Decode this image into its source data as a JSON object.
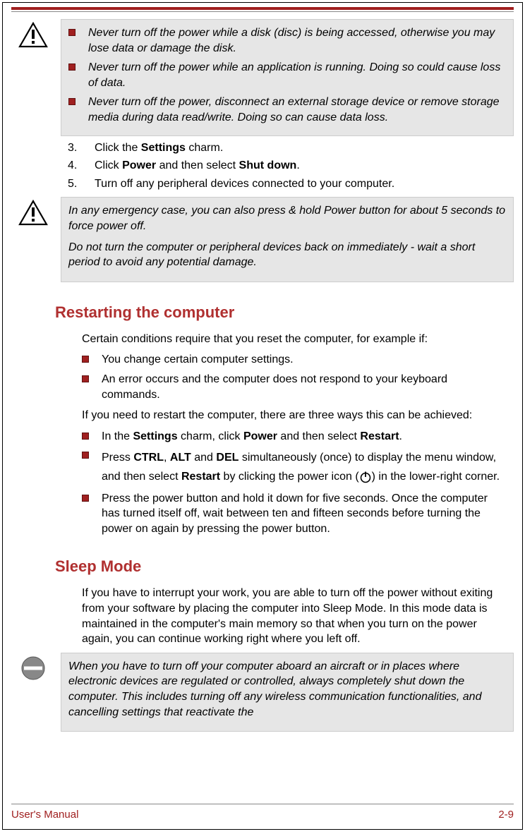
{
  "notice1": {
    "items": [
      "Never turn off the power while a disk (disc) is being accessed, otherwise you may lose data or damage the disk.",
      "Never turn off the power while an application is running. Doing so could cause loss of data.",
      "Never turn off the power, disconnect an external storage device or remove storage media during data read/write. Doing so can cause data loss."
    ]
  },
  "steps": {
    "n3": "3.",
    "t3_a": "Click the ",
    "t3_b": "Settings",
    "t3_c": " charm.",
    "n4": "4.",
    "t4_a": "Click ",
    "t4_b": "Power",
    "t4_c": " and then select ",
    "t4_d": "Shut down",
    "t4_e": ".",
    "n5": "5.",
    "t5": "Turn off any peripheral devices connected to your computer."
  },
  "notice2": {
    "p1": "In any emergency case, you can also press & hold Power button for about 5 seconds to force power off.",
    "p2": "Do not turn the computer or peripheral devices back on immediately - wait a short period to avoid any potential damage."
  },
  "restart": {
    "heading": "Restarting the computer",
    "intro": "Certain conditions require that you reset the computer, for example if:",
    "conds": [
      "You change certain computer settings.",
      "An error occurs and the computer does not respond to your keyboard commands."
    ],
    "midpara": "If you need to restart the computer, there are three ways this can be achieved:",
    "way1_a": "In the ",
    "way1_b": "Settings",
    "way1_c": " charm, click ",
    "way1_d": "Power",
    "way1_e": " and then select ",
    "way1_f": "Restart",
    "way1_g": ".",
    "way2_a": "Press ",
    "way2_b": "CTRL",
    "way2_c": ", ",
    "way2_d": "ALT",
    "way2_e": " and ",
    "way2_f": "DEL",
    "way2_g": " simultaneously (once) to display the menu window, and then select ",
    "way2_h": "Restart",
    "way2_i": " by clicking the power icon (",
    "way2_j": ") in the lower-right corner.",
    "way3": "Press the power button and hold it down for five seconds. Once the computer has turned itself off, wait between ten and fifteen seconds before turning the power on again by pressing the power button."
  },
  "sleep": {
    "heading": "Sleep Mode",
    "para": "If you have to interrupt your work, you are able to turn off the power without exiting from your software by placing the computer into Sleep Mode. In this mode data is maintained in the computer's main memory so that when you turn on the power again, you can continue working right where you left off."
  },
  "notice3": {
    "p1": "When you have to turn off your computer aboard an aircraft or in places where electronic devices are regulated or controlled, always completely shut down the computer. This includes turning off any wireless communication functionalities, and cancelling settings that reactivate the"
  },
  "footer": {
    "left": "User's Manual",
    "right": "2-9"
  }
}
